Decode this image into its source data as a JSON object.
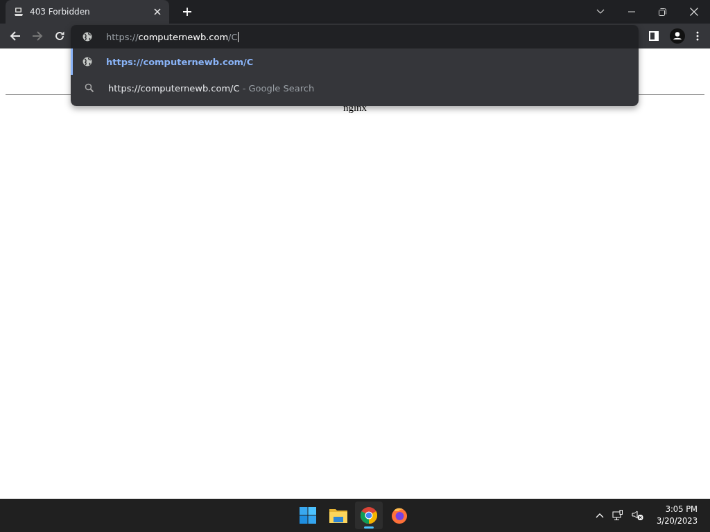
{
  "tab": {
    "title": "403 Forbidden",
    "selected": true
  },
  "nav": [
    {
      "kind": "back",
      "disabled": false
    },
    {
      "kind": "forward",
      "disabled": true
    },
    {
      "kind": "reload",
      "disabled": false
    }
  ],
  "omnibox": {
    "scheme": "https://",
    "host": "computernewb.com",
    "path": "/C"
  },
  "suggestions": [
    {
      "kind": "url",
      "text": "https://computernewb.com/C",
      "selected": true
    },
    {
      "kind": "search",
      "text": "https://computernewb.com/C",
      "suffix": "- Google Search",
      "selected": false
    }
  ],
  "page": {
    "footer": "nginx"
  },
  "taskbar": {
    "apps": [
      {
        "kind": "start",
        "selected": false
      },
      {
        "kind": "files",
        "selected": false
      },
      {
        "kind": "chrome",
        "selected": true
      },
      {
        "kind": "firefox",
        "selected": false
      }
    ],
    "time": "3:05 PM",
    "date": "3/20/2023"
  }
}
